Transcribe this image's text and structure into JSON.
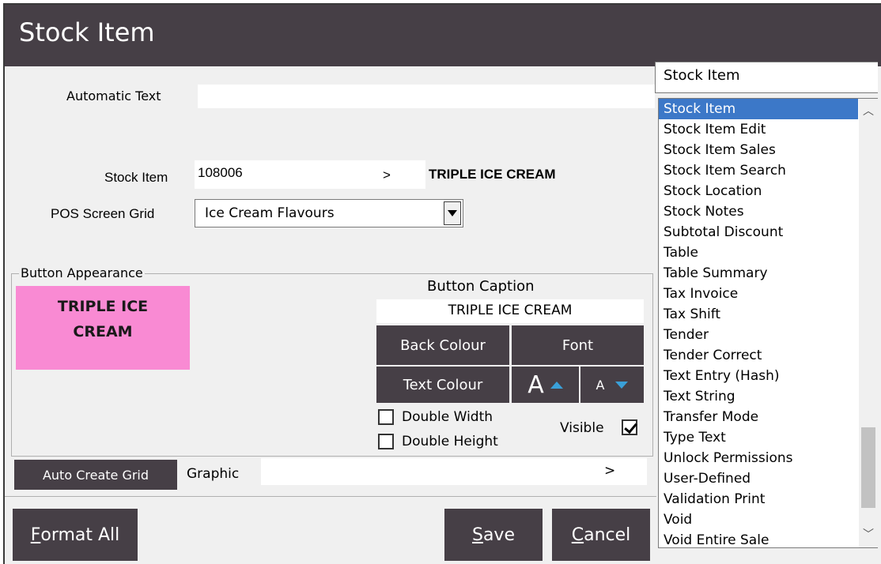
{
  "window": {
    "title": "Stock Item"
  },
  "form": {
    "automatic_text_label": "Automatic Text",
    "automatic_text_value": "",
    "stock_item_label": "Stock Item",
    "stock_item_code": "108006",
    "stock_item_lookup": ">",
    "stock_item_name": "TRIPLE ICE CREAM",
    "pos_grid_label": "POS Screen Grid",
    "pos_grid_value": "Ice Cream Flavours"
  },
  "appearance": {
    "group_title": "Button Appearance",
    "preview_text": "TRIPLE ICE CREAM",
    "preview_color": "#f98ad3",
    "caption_label": "Button Caption",
    "caption_value": "TRIPLE ICE CREAM",
    "back_colour": "Back Colour",
    "font": "Font",
    "text_colour": "Text Colour",
    "font_up_glyph": "A",
    "font_down_glyph": "A",
    "double_width": "Double Width",
    "double_height": "Double Height",
    "visible": "Visible",
    "visible_checked": true,
    "double_width_checked": false,
    "double_height_checked": false
  },
  "graphic": {
    "auto_create_grid": "Auto Create Grid",
    "label": "Graphic",
    "value": "",
    "lookup": ">"
  },
  "footer": {
    "format_all_first": "F",
    "format_all_rest": "ormat All",
    "save_first": "S",
    "save_rest": "ave",
    "cancel_first": "C",
    "cancel_rest": "ancel"
  },
  "function_list": {
    "header": "Stock Item",
    "selected_index": 0,
    "items": [
      "Stock Item",
      "Stock Item Edit",
      "Stock Item Sales",
      "Stock Item Search",
      "Stock Location",
      "Stock Notes",
      "Subtotal Discount",
      "Table",
      "Table Summary",
      "Tax Invoice",
      "Tax Shift",
      "Tender",
      "Tender Correct",
      "Text Entry (Hash)",
      "Text String",
      "Transfer Mode",
      "Type Text",
      "Unlock Permissions",
      "User-Defined",
      "Validation Print",
      "Void",
      "Void Entire Sale"
    ]
  },
  "colors": {
    "titlebar": "#463f46",
    "button": "#463f46",
    "selection": "#3c78c8",
    "arrow_accent": "#3aa0d8"
  }
}
